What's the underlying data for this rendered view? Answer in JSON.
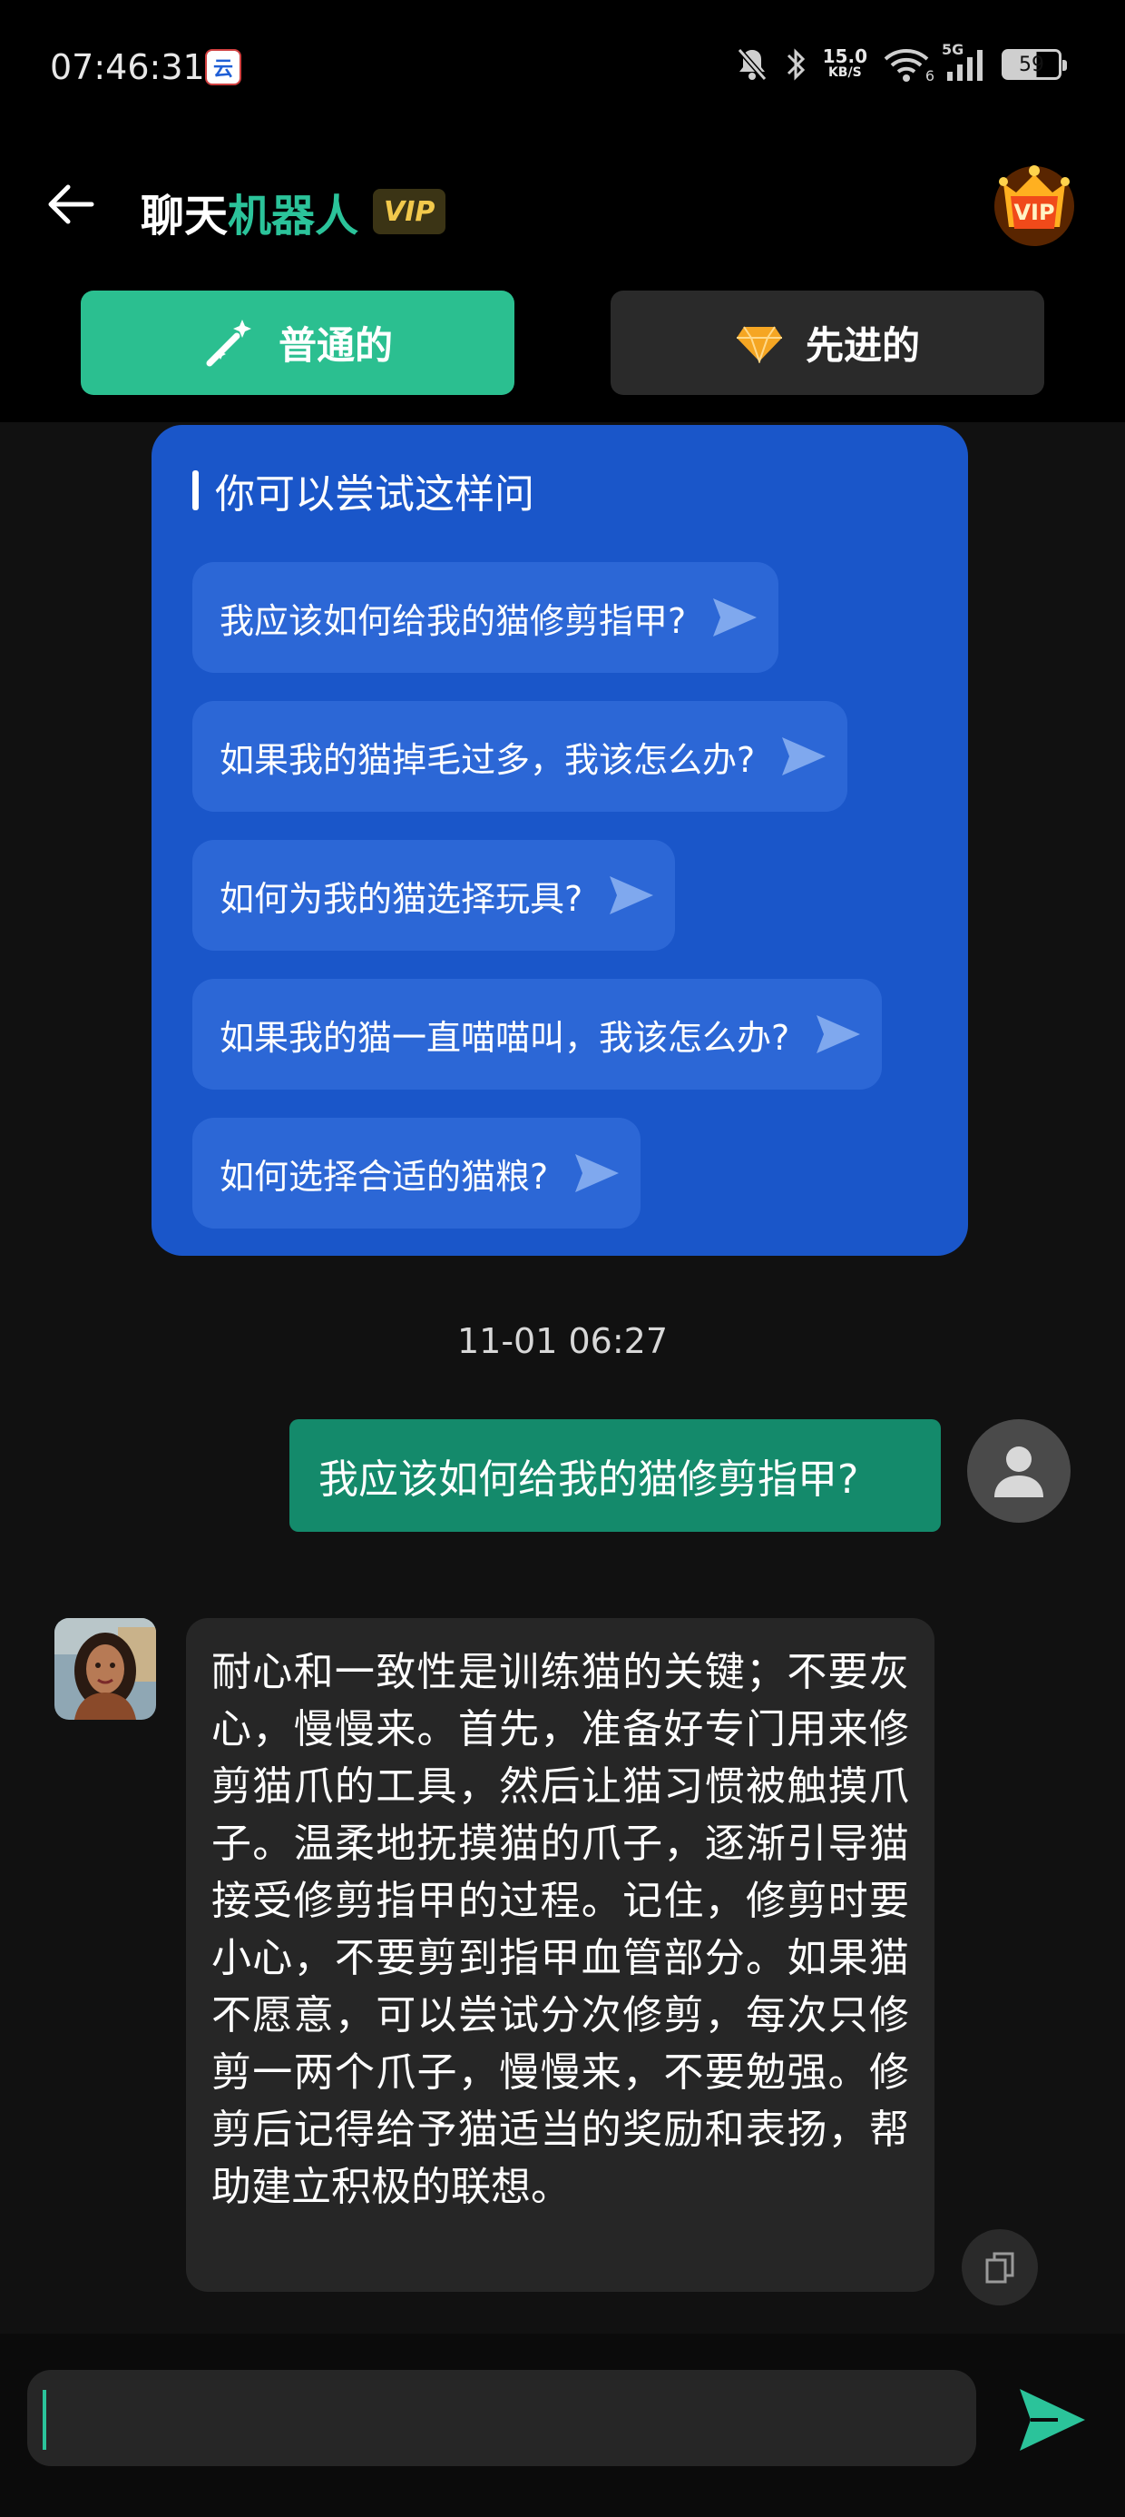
{
  "status_bar": {
    "time": "07:46:31",
    "app_notification_glyph": "云",
    "net_speed_value": "15.0",
    "net_speed_unit": "KB/S",
    "signal_label": "5G",
    "wifi_sub": "6",
    "battery": "59"
  },
  "header": {
    "title_part1": "聊天",
    "title_part2": "机器人",
    "vip_tag": "VIP",
    "vip_badge": "VIP"
  },
  "modes": {
    "normal_label": "普通的",
    "advanced_label": "先进的"
  },
  "suggestions": {
    "title": "你可以尝试这样问",
    "items": [
      "我应该如何给我的猫修剪指甲?",
      "如果我的猫掉毛过多，我该怎么办?",
      "如何为我的猫选择玩具?",
      "如果我的猫一直喵喵叫，我该怎么办?",
      "如何选择合适的猫粮?"
    ]
  },
  "chat": {
    "timestamp": "11-01 06:27",
    "user_message": "我应该如何给我的猫修剪指甲?",
    "bot_message": "耐心和一致性是训练猫的关键；不要灰心，慢慢来。首先，准备好专门用来修剪猫爪的工具，然后让猫习惯被触摸爪子。温柔地抚摸猫的爪子，逐渐引导猫接受修剪指甲的过程。记住，修剪时要小心，不要剪到指甲血管部分。如果猫不愿意，可以尝试分次修剪，每次只修剪一两个爪子，慢慢来，不要勉强。修剪后记得给予猫适当的奖励和表扬，帮助建立积极的联想。"
  },
  "input": {
    "value": "",
    "placeholder": ""
  },
  "colors": {
    "accent_green": "#2bc39a",
    "user_bubble": "#148a6b",
    "suggest_card": "#1a56c9",
    "suggest_chip": "#2c67d6"
  }
}
